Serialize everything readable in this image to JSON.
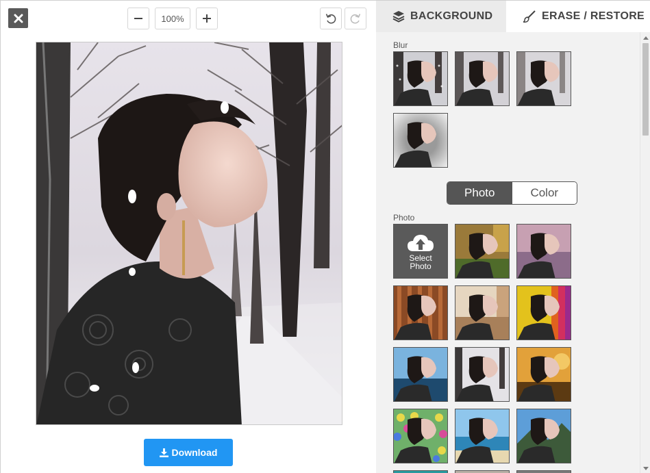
{
  "toolbar": {
    "zoom_value": "100%"
  },
  "actions": {
    "download_label": "Download"
  },
  "tabs": {
    "background_label": "BACKGROUND",
    "erase_label": "ERASE / RESTORE"
  },
  "panel": {
    "blur_label": "Blur",
    "photo_section_label": "Photo",
    "toggle": {
      "photo": "Photo",
      "color": "Color"
    },
    "select_photo_line1": "Select",
    "select_photo_line2": "Photo"
  },
  "colors": {
    "accent": "#2196f3",
    "dark_button": "#595959",
    "active_toggle": "#555555",
    "panel_bg": "#f2f2f2"
  }
}
